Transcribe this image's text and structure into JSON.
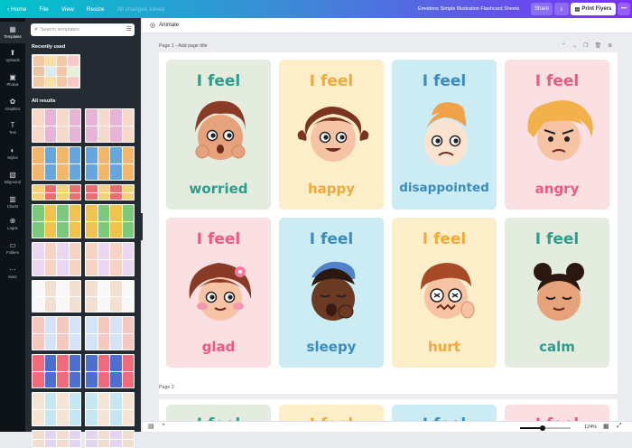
{
  "topbar": {
    "home": "Home",
    "file": "File",
    "view": "View",
    "resize": "Resize",
    "saved": "All changes saved",
    "title": "Emotions Simple Illustration Flashcard Sheets",
    "share": "Share",
    "print": "Print Flyers"
  },
  "rail": {
    "items": [
      {
        "label": "Templates",
        "icon": "▦"
      },
      {
        "label": "Uploads",
        "icon": "⬆"
      },
      {
        "label": "Photos",
        "icon": "▣"
      },
      {
        "label": "Graphics",
        "icon": "✿"
      },
      {
        "label": "Text",
        "icon": "T"
      },
      {
        "label": "Styles",
        "icon": "◐"
      },
      {
        "label": "Bkground",
        "icon": "▧"
      },
      {
        "label": "Charts",
        "icon": "▥"
      },
      {
        "label": "Logos",
        "icon": "⊕"
      },
      {
        "label": "Folders",
        "icon": "▭"
      },
      {
        "label": "More",
        "icon": "⋯"
      }
    ]
  },
  "panel": {
    "search_placeholder": "Search templates",
    "recently_used": "Recently used",
    "all_results": "All results"
  },
  "editor": {
    "animate": "Animate",
    "page1_label": "Page 1 - Add page title",
    "page2_label": "Page 2",
    "zoom": "124%",
    "zoom_fraction": 0.45
  },
  "cards": [
    {
      "feel": "I feel",
      "word": "worried",
      "bg": "#e4ece0",
      "feel_color": "#2f9c8c",
      "word_color": "#2f9c8c"
    },
    {
      "feel": "I feel",
      "word": "happy",
      "bg": "#fbeec8",
      "feel_color": "#f0a93a",
      "word_color": "#f0a93a"
    },
    {
      "feel": "I feel",
      "word": "disappointed",
      "bg": "#ccecf3",
      "feel_color": "#3b8bbf",
      "word_color": "#3b8bbf"
    },
    {
      "feel": "I feel",
      "word": "angry",
      "bg": "#fbe0e3",
      "feel_color": "#ec5a84",
      "word_color": "#ec5a84"
    },
    {
      "feel": "I feel",
      "word": "glad",
      "bg": "#fbe0e3",
      "feel_color": "#ec5a84",
      "word_color": "#ec5a84"
    },
    {
      "feel": "I feel",
      "word": "sleepy",
      "bg": "#ccecf3",
      "feel_color": "#3b8bbf",
      "word_color": "#3b8bbf"
    },
    {
      "feel": "I feel",
      "word": "hurt",
      "bg": "#fbeec8",
      "feel_color": "#f0a93a",
      "word_color": "#f0a93a"
    },
    {
      "feel": "I feel",
      "word": "calm",
      "bg": "#e4ece0",
      "feel_color": "#2f9c8c",
      "word_color": "#2f9c8c"
    }
  ],
  "page2_cards": [
    {
      "feel": "I feel",
      "bg": "#e4ece0",
      "color": "#2f9c8c"
    },
    {
      "feel": "I feel",
      "bg": "#fbeec8",
      "color": "#f0a93a"
    },
    {
      "feel": "I feel",
      "bg": "#ccecf3",
      "color": "#3b8bbf"
    },
    {
      "feel": "I feel",
      "bg": "#fbe0e3",
      "color": "#ec5a84"
    }
  ]
}
